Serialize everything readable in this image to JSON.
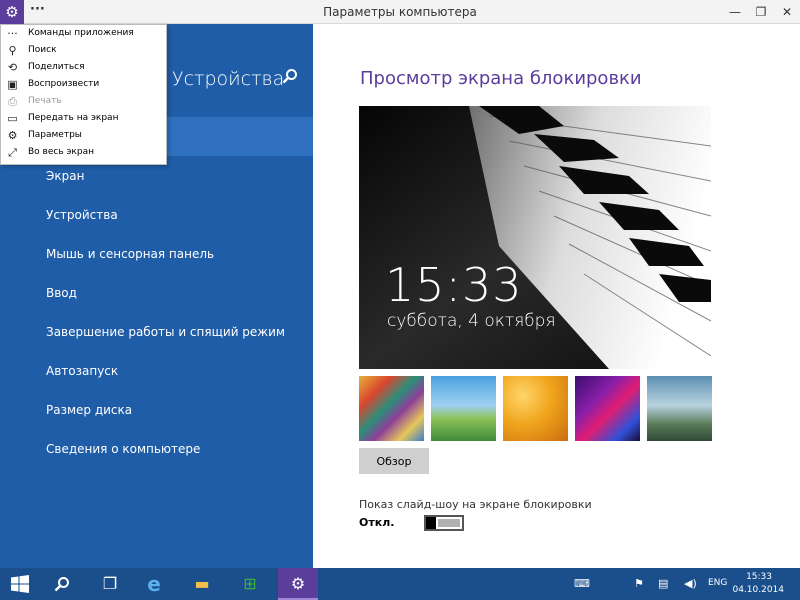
{
  "window": {
    "title": "Параметры компьютера",
    "menu_dots": "···",
    "min": "—",
    "max": "❐",
    "close": "✕"
  },
  "app_commands": [
    {
      "label": "Команды приложения",
      "icon": "···",
      "disabled": false
    },
    {
      "label": "Поиск",
      "icon": "⚲",
      "disabled": false
    },
    {
      "label": "Поделиться",
      "icon": "⟲",
      "disabled": false
    },
    {
      "label": "Воспроизвести",
      "icon": "▣",
      "disabled": false
    },
    {
      "label": "Печать",
      "icon": "⎙",
      "disabled": true
    },
    {
      "label": "Передать на экран",
      "icon": "▭",
      "disabled": false
    },
    {
      "label": "Параметры",
      "icon": "⚙",
      "disabled": false
    },
    {
      "label": "Во весь экран",
      "icon": "⤢",
      "disabled": false
    }
  ],
  "sidebar": {
    "title": "Устройства",
    "items": [
      "Экран",
      "Устройства",
      "Мышь и сенсорная панель",
      "Ввод",
      "Завершение работы и спящий режим",
      "Автозапуск",
      "Размер диска",
      "Сведения о компьютере"
    ]
  },
  "main": {
    "heading": "Просмотр экрана блокировки",
    "lock_time": "15:33",
    "lock_date": "суббота, 4 октября",
    "browse_button": "Обзор",
    "slideshow_label": "Показ слайд-шоу на экране блокировки",
    "toggle_state": "Откл."
  },
  "taskbar": {
    "start_icon": "⊞",
    "search_icon": "⚲",
    "task_icon": "❐",
    "ie_icon": "e",
    "explorer_icon": "▬",
    "store_icon": "⊞",
    "settings_icon": "⚙",
    "keyboard_icon": "⌨",
    "flag_icon": "⚑",
    "network_icon": "▤",
    "volume_icon": "◀)",
    "language": "ENG",
    "clock_time": "15:33",
    "clock_date": "04.10.2014"
  },
  "colors": {
    "sidebar_bg": "#1f5da8",
    "accent": "#5b3d9c",
    "taskbar": "#1a4f8c"
  }
}
